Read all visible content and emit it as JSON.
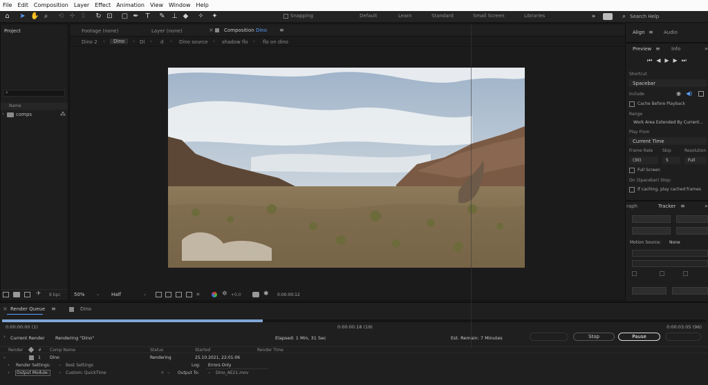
{
  "menu": [
    "File",
    "Edit",
    "Composition",
    "Layer",
    "Effect",
    "Animation",
    "View",
    "Window",
    "Help"
  ],
  "toolbar": {
    "snapping": "Snapping",
    "workspaces": [
      "Default",
      "Learn",
      "Standard",
      "Small Screen",
      "Libraries"
    ],
    "search": "Search Help"
  },
  "project": {
    "title": "Project",
    "col_name": "Name",
    "folder": "comps",
    "bpc": "8 bpc"
  },
  "viewer": {
    "footage": "Footage",
    "footage_val": "(none)",
    "layer": "Layer",
    "layer_val": "(none)",
    "comp_label": "Composition",
    "comp_name": "Dino",
    "breadcrumbs": [
      "Dino 2",
      "Dino",
      "Dl",
      "d",
      "Dino source",
      "shadow flo",
      "flo on dino"
    ],
    "zoom": "50%",
    "resolution": "Half",
    "exposure": "+0,0",
    "timecode": "0:00:00:12"
  },
  "right": {
    "tabs": [
      "Align",
      "Audio"
    ],
    "tabs2": [
      "Preview",
      "Info"
    ],
    "shortcut_label": "Shortcut",
    "shortcut": "Spacebar",
    "include_label": "Include",
    "cache": "Cache Before Playback",
    "range_label": "Range",
    "range": "Work Area Extended By Current...",
    "playfrom_label": "Play From",
    "playfrom": "Current Time",
    "framerate_label": "Frame Rate",
    "skip_label": "Skip",
    "resolution_label": "Resolution",
    "framerate": "(30)",
    "skip": "5",
    "resolution": "Full",
    "fullscreen": "Full Screen",
    "stop_label": "On (Spacebar) Stop:",
    "ifcaching": "If caching, play cached frames",
    "tracker_tabs": [
      "raph",
      "Tracker"
    ],
    "motion_source_label": "Motion Source:",
    "motion_source": "None"
  },
  "render": {
    "tab": "Render Queue",
    "tab2": "Dino",
    "tc_start": "0:00:00:00 (1)",
    "tc_mid": "0:00:00:18 (19)",
    "tc_end": "0:00:03:05 (96)",
    "progress": 0.37,
    "current_render": "Current Render",
    "rendering": "Rendering \"Dino\"",
    "elapsed": "Elapsed: 1 Min, 31 Sec",
    "remain": "Est. Remain: 7 Minutes",
    "stop": "Stop",
    "pause": "Pause",
    "cols": [
      "Render",
      "#",
      "Comp Name",
      "Status",
      "Started",
      "Render Time"
    ],
    "row": {
      "num": "1",
      "comp": "Dino",
      "status": "Rendering",
      "started": "25.10.2021, 22:01:06"
    },
    "settings_label": "Render Settings:",
    "settings": "Best Settings",
    "log_label": "Log:",
    "log": "Errors Only",
    "output_label": "Output Module:",
    "output": "Custom: QuickTime",
    "outputto_label": "Output To:",
    "outputto": "Dino_AE21.mov"
  }
}
